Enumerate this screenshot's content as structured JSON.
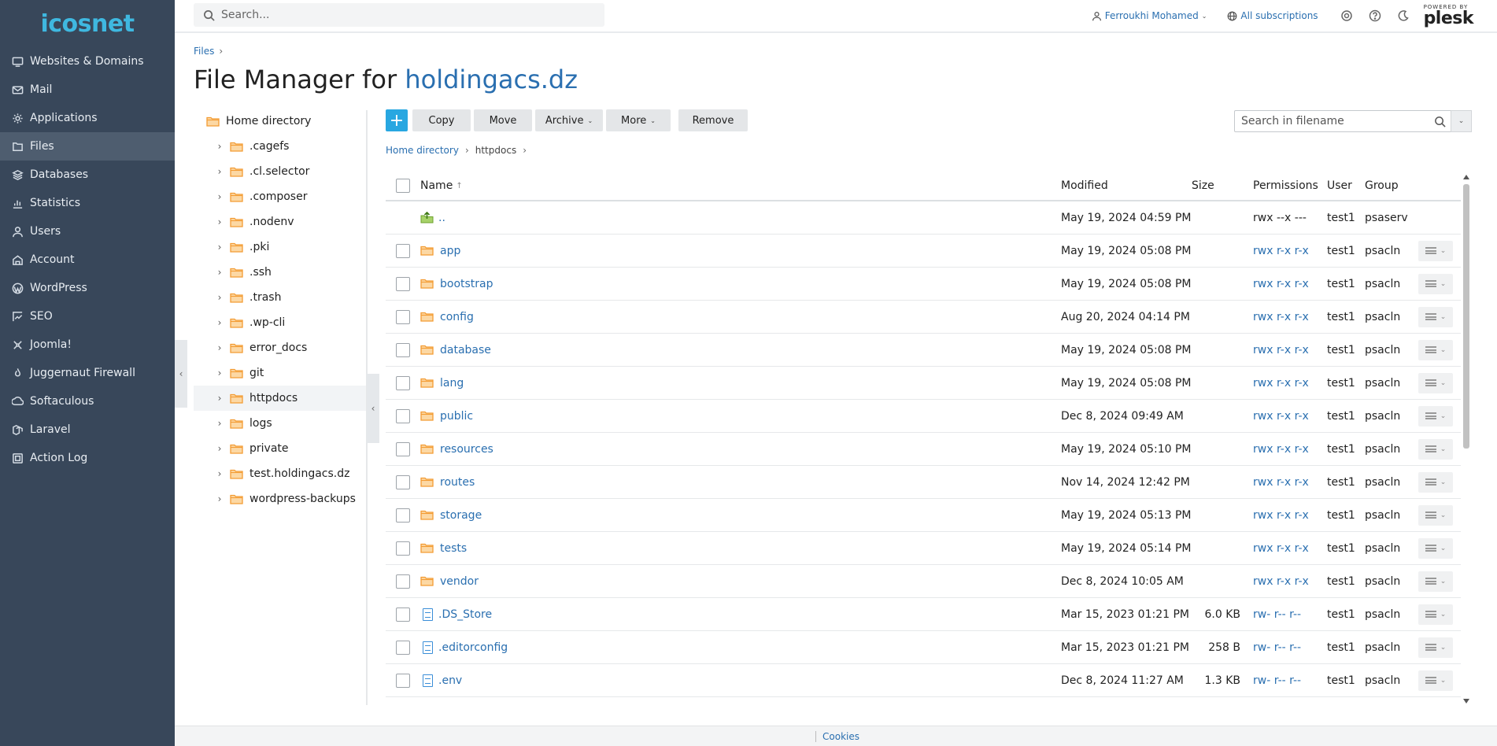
{
  "brand": {
    "logo_text": "icosnet"
  },
  "sidebar": {
    "items": [
      {
        "label": "Websites & Domains",
        "icon": "monitor-icon"
      },
      {
        "label": "Mail",
        "icon": "mail-icon"
      },
      {
        "label": "Applications",
        "icon": "gear-icon"
      },
      {
        "label": "Files",
        "icon": "files-icon",
        "active": true
      },
      {
        "label": "Databases",
        "icon": "database-icon"
      },
      {
        "label": "Statistics",
        "icon": "chart-icon"
      },
      {
        "label": "Users",
        "icon": "user-icon"
      },
      {
        "label": "Account",
        "icon": "account-icon"
      },
      {
        "label": "WordPress",
        "icon": "wordpress-icon"
      },
      {
        "label": "SEO",
        "icon": "seo-icon"
      },
      {
        "label": "Joomla!",
        "icon": "joomla-icon"
      },
      {
        "label": "Juggernaut Firewall",
        "icon": "firewall-icon"
      },
      {
        "label": "Softaculous",
        "icon": "softaculous-icon"
      },
      {
        "label": "Laravel",
        "icon": "laravel-icon"
      },
      {
        "label": "Action Log",
        "icon": "log-icon"
      }
    ]
  },
  "topbar": {
    "search_placeholder": "Search...",
    "user_name": "Ferroukhi Mohamed",
    "subscriptions": "All subscriptions",
    "powered_by": "POWERED BY",
    "plesk": "plesk"
  },
  "header": {
    "breadcrumb": "Files",
    "title_prefix": "File Manager for",
    "domain": "holdingacs.dz"
  },
  "tree": {
    "root": "Home directory",
    "children": [
      ".cagefs",
      ".cl.selector",
      ".composer",
      ".nodenv",
      ".pki",
      ".ssh",
      ".trash",
      ".wp-cli",
      "error_docs",
      "git",
      "httpdocs",
      "logs",
      "private",
      "test.holdingacs.dz",
      "wordpress-backups"
    ],
    "selected": "httpdocs"
  },
  "toolbar": {
    "add": "+",
    "copy": "Copy",
    "move": "Move",
    "archive": "Archive",
    "more": "More",
    "remove": "Remove",
    "search_placeholder": "Search in filename"
  },
  "path": {
    "root": "Home directory",
    "current": "httpdocs"
  },
  "table": {
    "headers": {
      "name": "Name",
      "modified": "Modified",
      "size": "Size",
      "permissions": "Permissions",
      "user": "User",
      "group": "Group"
    },
    "rows": [
      {
        "name": "..",
        "type": "up",
        "modified": "May 19, 2024 04:59 PM",
        "size": "",
        "perm": "rwx --x ---",
        "user": "test1",
        "group": "psaserv"
      },
      {
        "name": "app",
        "type": "folder",
        "modified": "May 19, 2024 05:08 PM",
        "size": "",
        "perm": "rwx r-x r-x",
        "user": "test1",
        "group": "psacln"
      },
      {
        "name": "bootstrap",
        "type": "folder",
        "modified": "May 19, 2024 05:08 PM",
        "size": "",
        "perm": "rwx r-x r-x",
        "user": "test1",
        "group": "psacln"
      },
      {
        "name": "config",
        "type": "folder",
        "modified": "Aug 20, 2024 04:14 PM",
        "size": "",
        "perm": "rwx r-x r-x",
        "user": "test1",
        "group": "psacln"
      },
      {
        "name": "database",
        "type": "folder",
        "modified": "May 19, 2024 05:08 PM",
        "size": "",
        "perm": "rwx r-x r-x",
        "user": "test1",
        "group": "psacln"
      },
      {
        "name": "lang",
        "type": "folder",
        "modified": "May 19, 2024 05:08 PM",
        "size": "",
        "perm": "rwx r-x r-x",
        "user": "test1",
        "group": "psacln"
      },
      {
        "name": "public",
        "type": "folder",
        "modified": "Dec 8, 2024 09:49 AM",
        "size": "",
        "perm": "rwx r-x r-x",
        "user": "test1",
        "group": "psacln"
      },
      {
        "name": "resources",
        "type": "folder",
        "modified": "May 19, 2024 05:10 PM",
        "size": "",
        "perm": "rwx r-x r-x",
        "user": "test1",
        "group": "psacln"
      },
      {
        "name": "routes",
        "type": "folder",
        "modified": "Nov 14, 2024 12:42 PM",
        "size": "",
        "perm": "rwx r-x r-x",
        "user": "test1",
        "group": "psacln"
      },
      {
        "name": "storage",
        "type": "folder",
        "modified": "May 19, 2024 05:13 PM",
        "size": "",
        "perm": "rwx r-x r-x",
        "user": "test1",
        "group": "psacln"
      },
      {
        "name": "tests",
        "type": "folder",
        "modified": "May 19, 2024 05:14 PM",
        "size": "",
        "perm": "rwx r-x r-x",
        "user": "test1",
        "group": "psacln"
      },
      {
        "name": "vendor",
        "type": "folder",
        "modified": "Dec 8, 2024 10:05 AM",
        "size": "",
        "perm": "rwx r-x r-x",
        "user": "test1",
        "group": "psacln"
      },
      {
        "name": ".DS_Store",
        "type": "file",
        "modified": "Mar 15, 2023 01:21 PM",
        "size": "6.0 KB",
        "perm": "rw- r-- r--",
        "user": "test1",
        "group": "psacln"
      },
      {
        "name": ".editorconfig",
        "type": "file",
        "modified": "Mar 15, 2023 01:21 PM",
        "size": "258 B",
        "perm": "rw- r-- r--",
        "user": "test1",
        "group": "psacln"
      },
      {
        "name": ".env",
        "type": "file",
        "modified": "Dec 8, 2024 11:27 AM",
        "size": "1.3 KB",
        "perm": "rw- r-- r--",
        "user": "test1",
        "group": "psacln"
      }
    ]
  },
  "footer": {
    "cookies": "Cookies"
  },
  "colors": {
    "sidebar": "#38475a",
    "accent": "#28a7e1",
    "link": "#2a6fb0",
    "folder": "#f5a23a"
  }
}
